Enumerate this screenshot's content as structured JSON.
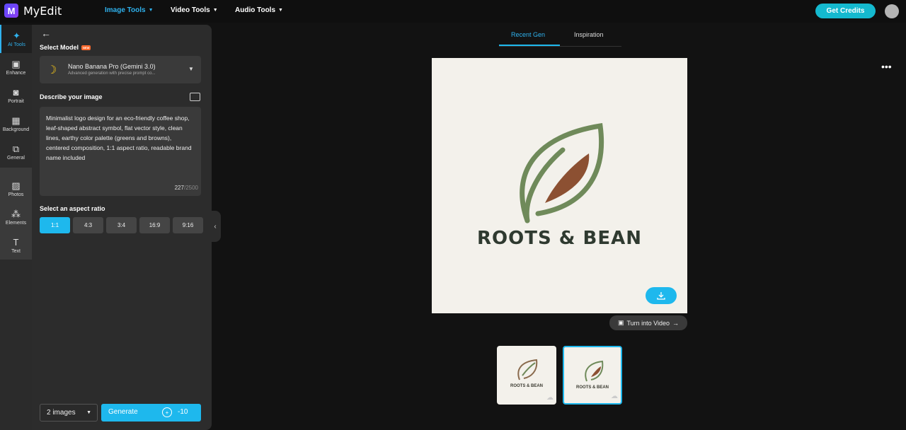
{
  "app": {
    "name": "MyEdit"
  },
  "nav": [
    {
      "label": "Image Tools",
      "active": true
    },
    {
      "label": "Video Tools",
      "active": false
    },
    {
      "label": "Audio Tools",
      "active": false
    }
  ],
  "header": {
    "credits_label": "Get Credits"
  },
  "rail": [
    {
      "label": "AI Tools",
      "icon": "magic-wand-icon"
    },
    {
      "label": "Enhance",
      "icon": "enhance-icon"
    },
    {
      "label": "Portrait",
      "icon": "portrait-icon"
    },
    {
      "label": "Background",
      "icon": "background-icon"
    },
    {
      "label": "General",
      "icon": "general-icon"
    },
    {
      "label": "Photos",
      "icon": "photos-icon"
    },
    {
      "label": "Elements",
      "icon": "elements-icon"
    },
    {
      "label": "Text",
      "icon": "text-icon"
    }
  ],
  "panel": {
    "select_model_label": "Select Model",
    "new_badge": "NEW",
    "model_name": "Nano Banana Pro (Gemini 3.0)",
    "model_desc": "Advanced generation with precise prompt co...",
    "describe_label": "Describe your image",
    "prompt": "Minimalist logo design for an eco-friendly coffee shop, leaf-shaped abstract symbol, flat vector style, clean lines, earthy color palette (greens and browns), centered composition, 1:1 aspect ratio, readable brand name included",
    "char_count": "227",
    "char_max": "/2500",
    "aspect_label": "Select an aspect ratio",
    "ratios": [
      "1:1",
      "4:3",
      "3:4",
      "16:9",
      "9:16"
    ],
    "image_count": "2 images",
    "generate_label": "Generate",
    "generate_cost": "-10"
  },
  "main": {
    "tabs": [
      "Recent Gen",
      "Inspiration"
    ],
    "brand_name": "ROOTS & BEAN",
    "turn_into_video": "Turn into Video",
    "thumbnails": [
      "ROOTS & BEAN",
      "ROOTS & BEAN"
    ]
  }
}
